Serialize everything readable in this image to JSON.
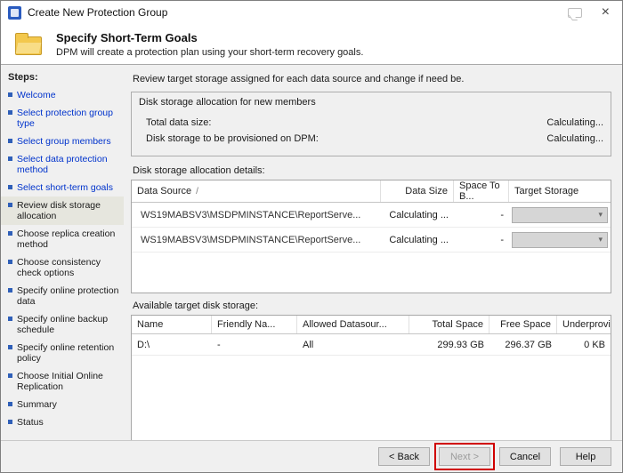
{
  "window": {
    "title": "Create New Protection Group"
  },
  "titlebar": {
    "close_glyph": "×"
  },
  "header": {
    "title": "Specify Short-Term Goals",
    "subtitle": "DPM will create a protection plan using your short-term recovery goals."
  },
  "sidebar": {
    "heading": "Steps:",
    "items": [
      {
        "label": "Welcome"
      },
      {
        "label": "Select protection group type"
      },
      {
        "label": "Select group members"
      },
      {
        "label": "Select data protection method"
      },
      {
        "label": "Select short-term goals"
      },
      {
        "label": "Review disk storage allocation"
      },
      {
        "label": "Choose replica creation method"
      },
      {
        "label": "Choose consistency check options"
      },
      {
        "label": "Specify online protection data"
      },
      {
        "label": "Specify online backup schedule"
      },
      {
        "label": "Specify online retention policy"
      },
      {
        "label": "Choose Initial Online Replication"
      },
      {
        "label": "Summary"
      },
      {
        "label": "Status"
      }
    ]
  },
  "main": {
    "intro": "Review target storage assigned for each data source and change if need be.",
    "allocation": {
      "title": "Disk storage allocation for new members",
      "rows": [
        {
          "label": "Total data size:",
          "value": "Calculating..."
        },
        {
          "label": "Disk storage to be provisioned on DPM:",
          "value": "Calculating..."
        }
      ]
    },
    "details_label": "Disk storage allocation details:",
    "details_table": {
      "columns": {
        "data_source": "Data Source",
        "data_size": "Data Size",
        "space": "Space To B...",
        "target": "Target Storage"
      },
      "sort_glyph": "/",
      "dropdown_glyph": "▾",
      "rows": [
        {
          "data_source": "WS19MABSV3\\MSDPMINSTANCE\\ReportServe...",
          "data_size": "Calculating ...",
          "space": "-"
        },
        {
          "data_source": "WS19MABSV3\\MSDPMINSTANCE\\ReportServe...",
          "data_size": "Calculating ...",
          "space": "-"
        }
      ]
    },
    "available_label": "Available target disk storage:",
    "available_table": {
      "columns": {
        "name": "Name",
        "friendly": "Friendly Na...",
        "allowed": "Allowed Datasour...",
        "total": "Total Space",
        "free": "Free Space",
        "under": "Underprovi..."
      },
      "rows": [
        {
          "name": "D:\\",
          "friendly": "-",
          "allowed": "All",
          "total": "299.93 GB",
          "free": "296.37 GB",
          "under": "0 KB"
        }
      ]
    }
  },
  "footer": {
    "back": "< Back",
    "next": "Next >",
    "cancel": "Cancel",
    "help": "Help"
  }
}
